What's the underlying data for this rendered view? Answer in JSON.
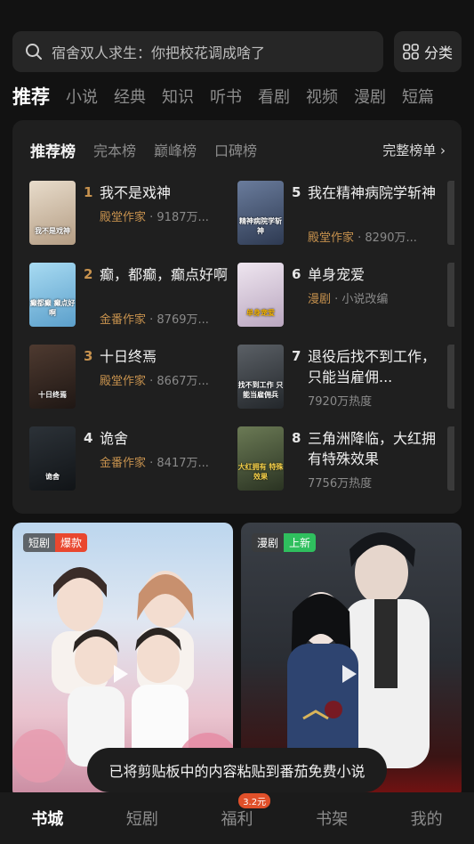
{
  "search": {
    "query": "宿舍双人求生：你把校花调成啥了",
    "category_label": "分类"
  },
  "tabs": [
    "推荐",
    "小说",
    "经典",
    "知识",
    "听书",
    "看剧",
    "视频",
    "漫剧",
    "短篇"
  ],
  "ranking": {
    "tabs": [
      "推荐榜",
      "完本榜",
      "巅峰榜",
      "口碑榜"
    ],
    "more_label": "完整榜单 ›",
    "books": [
      {
        "rank": "1",
        "title": "我不是戏神",
        "author": "殿堂作家",
        "heat": " · 9187万...",
        "cover_text": "我不是戏神",
        "cover_color": "#c8b9a6"
      },
      {
        "rank": "2",
        "title": "癫，都癫，癫点好啊",
        "author": "金番作家",
        "heat": " · 8769万...",
        "cover_text": "癫都癫 癫点好啊",
        "cover_color": "#6fb5d8"
      },
      {
        "rank": "3",
        "title": "十日终焉",
        "author": "殿堂作家",
        "heat": " · 8667万...",
        "cover_text": "十日终焉",
        "cover_color": "#3a2a24"
      },
      {
        "rank": "4",
        "title": "诡舍",
        "author": "金番作家",
        "heat": " · 8417万...",
        "cover_text": "诡舍",
        "cover_color": "#1e2328"
      },
      {
        "rank": "5",
        "title": "我在精神病院学斩神",
        "author": "殿堂作家",
        "heat": " · 8290万...",
        "cover_text": "精神病院学斩神",
        "cover_color": "#4a5a78"
      },
      {
        "rank": "6",
        "title": "单身宠爱",
        "author": "漫剧",
        "heat": " · 小说改编",
        "cover_text": "单身宠爱",
        "cover_color": "#d6cbd8"
      },
      {
        "rank": "7",
        "title": "退役后找不到工作，只能当雇佣...",
        "author": "",
        "heat": "7920万热度",
        "cover_text": "找不到工作 只能当雇佣兵",
        "cover_color": "#3b3f44"
      },
      {
        "rank": "8",
        "title": "三角洲降临，大红拥有特殊效果",
        "author": "",
        "heat": "7756万热度",
        "cover_text": "大红拥有 特殊效果",
        "cover_color": "#4c5a3c"
      }
    ]
  },
  "videos": [
    {
      "type": "短剧",
      "tag": "爆款",
      "tag_color": "#e9472f"
    },
    {
      "type": "漫剧",
      "tag": "上新",
      "tag_color": "#2fbf5e"
    }
  ],
  "toast": "已将剪贴板中的内容粘贴到番茄免费小说",
  "bottom_nav": {
    "items": [
      "书城",
      "短剧",
      "福利",
      "书架",
      "我的"
    ],
    "badge": "3.2元"
  },
  "colors": {
    "rank_top": "#c7924e",
    "rank_other": "#e6e6e6",
    "author": "#c7924e"
  }
}
